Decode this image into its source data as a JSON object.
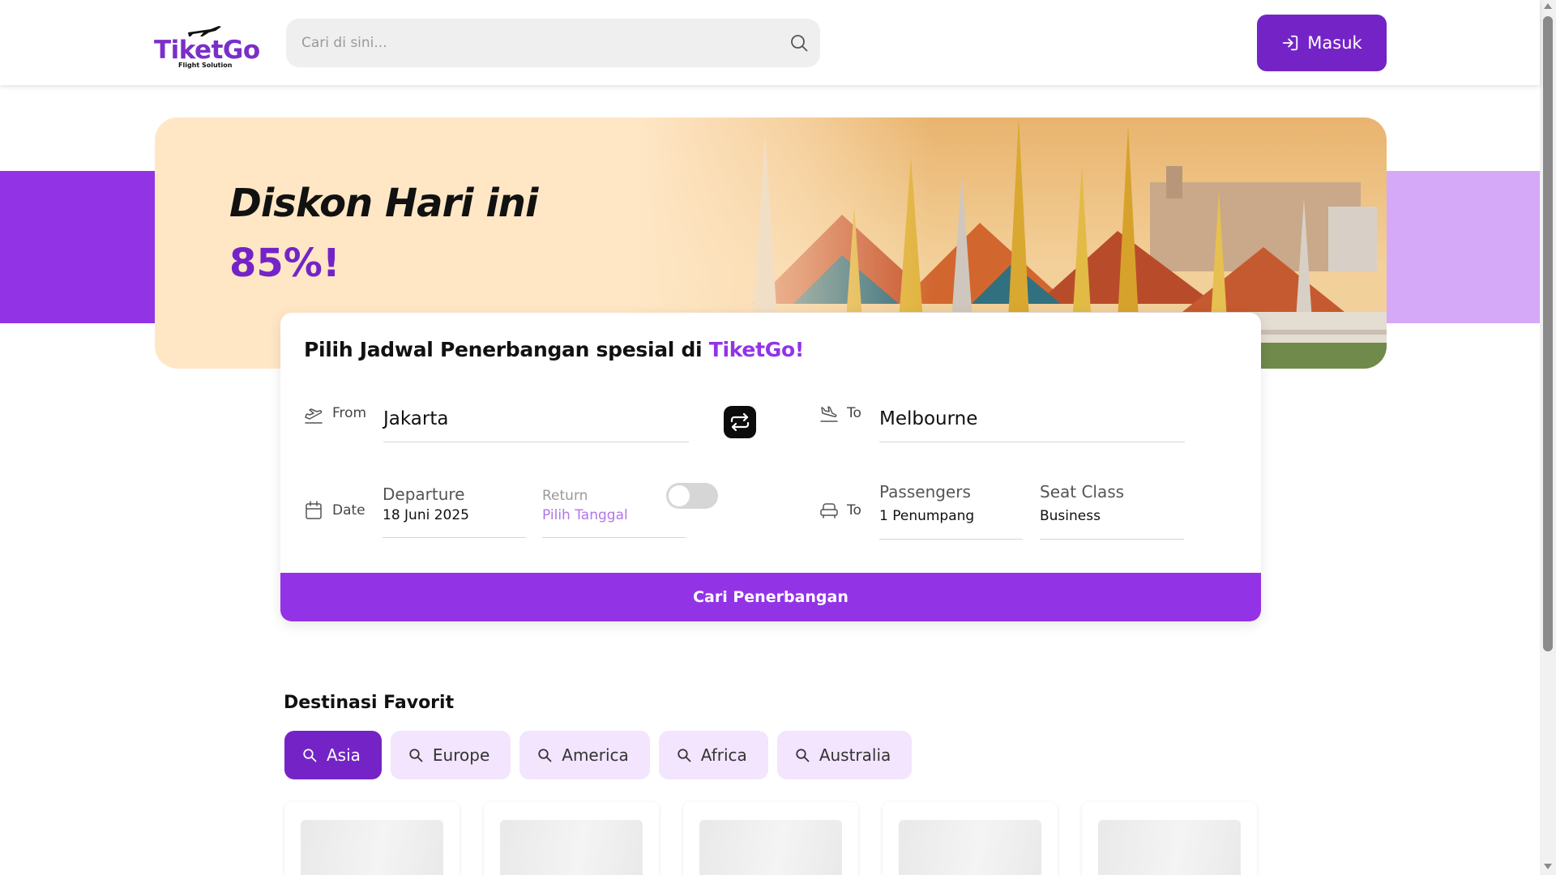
{
  "header": {
    "logo_text": "TiketGo",
    "logo_subtitle": "Flight Solution",
    "search_placeholder": "Cari di sini...",
    "login_label": "Masuk"
  },
  "hero": {
    "title": "Diskon Hari ini",
    "discount": "85%!"
  },
  "booking": {
    "title_prefix": "Pilih Jadwal Penerbangan spesial di ",
    "title_brand": "TiketGo!",
    "from_label": "From",
    "from_value": "Jakarta",
    "to_label": "To",
    "to_value": "Melbourne",
    "date_label": "Date",
    "departure_label": "Departure",
    "departure_value": "18 Juni 2025",
    "return_label": "Return",
    "return_value": "Pilih Tanggal",
    "return_toggle_on": false,
    "passenger_to_label": "To",
    "passengers_label": "Passengers",
    "passengers_value": "1 Penumpang",
    "seat_class_label": "Seat Class",
    "seat_class_value": "Business",
    "search_button": "Cari Penerbangan"
  },
  "favorites": {
    "title": "Destinasi Favorit",
    "tabs": [
      {
        "label": "Asia",
        "active": true
      },
      {
        "label": "Europe",
        "active": false
      },
      {
        "label": "America",
        "active": false
      },
      {
        "label": "Africa",
        "active": false
      },
      {
        "label": "Australia",
        "active": false
      }
    ]
  },
  "colors": {
    "brand_purple": "#7424c6",
    "accent_purple": "#9234e6",
    "light_purple": "#d5a9f8",
    "banner_cream": "#ffe7c6",
    "tab_bg": "#f2e5fd"
  },
  "icons": {
    "search": "search-icon",
    "login": "login-icon",
    "takeoff": "takeoff-icon",
    "landing": "landing-icon",
    "swap": "swap-icon",
    "calendar": "calendar-icon",
    "seat": "seat-icon"
  }
}
